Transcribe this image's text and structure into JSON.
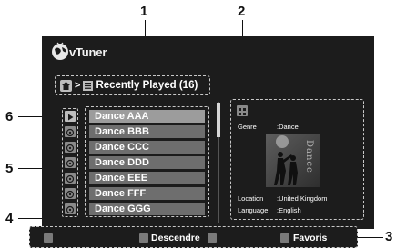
{
  "app": {
    "name": "vTuner"
  },
  "breadcrumb": {
    "separator": ">",
    "current": "Recently Played (16)"
  },
  "list": {
    "items": [
      {
        "label": "Dance AAA",
        "selected": true
      },
      {
        "label": "Dance BBB",
        "selected": false
      },
      {
        "label": "Dance CCC",
        "selected": false
      },
      {
        "label": "Dance DDD",
        "selected": false
      },
      {
        "label": "Dance EEE",
        "selected": false
      },
      {
        "label": "Dance FFF",
        "selected": false
      },
      {
        "label": "Dance GGG",
        "selected": false
      }
    ]
  },
  "side_icons": [
    "play-icon",
    "station-icon",
    "station-icon",
    "station-icon",
    "station-icon",
    "station-icon",
    "station-icon"
  ],
  "info": {
    "genre_label": "Genre",
    "genre_value": ":Dance",
    "location_label": "Location",
    "location_value": ":United Kingdom",
    "language_label": "Language",
    "language_value": ":English",
    "art_text": "Dance"
  },
  "bottombar": {
    "key1_color": "#7a7a7a",
    "descendre_label": "Descendre",
    "favoris_label": "Favoris"
  },
  "callouts": {
    "c1": "1",
    "c2": "2",
    "c3": "3",
    "c4": "4",
    "c5": "5",
    "c6": "6"
  },
  "colors": {
    "screen_bg": "#1c1c1c",
    "item_bg": "#6e6e6e",
    "item_selected_bg": "#9c9c9c"
  }
}
